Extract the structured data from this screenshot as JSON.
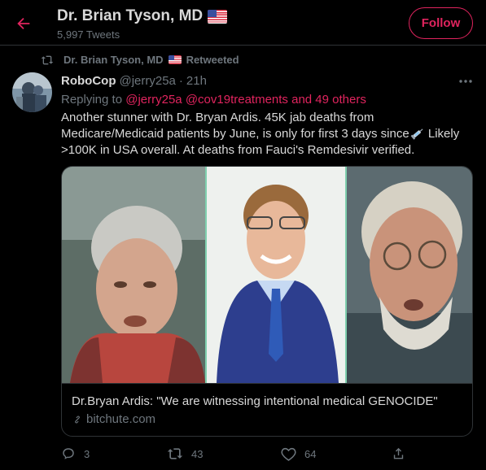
{
  "header": {
    "title": "Dr. Brian Tyson, MD",
    "tweet_count": "5,997 Tweets",
    "follow_label": "Follow"
  },
  "retweet": {
    "label": "Dr. Brian Tyson, MD",
    "suffix": "Retweeted"
  },
  "tweet": {
    "username": "RoboCop",
    "handle": "@jerry25a",
    "separator": "·",
    "time": "21h",
    "replying_prefix": "Replying to",
    "replying_mention1": "@jerry25a",
    "replying_mention2": "@cov19treatments",
    "replying_others": "and 49 others",
    "text_part1": "Another stunner with Dr. Bryan Ardis. 45K jab deaths from Medicare/Medicaid patients by June, is only for first 3 days since",
    "text_part2": " Likely >100K in USA overall. At deaths from Fauci's Remdesivir verified.",
    "emoji_icon": "syringe-icon"
  },
  "card": {
    "title": "Dr.Bryan Ardis: \"We are witnessing intentional medical GENOCIDE\"",
    "domain": "bitchute.com"
  },
  "actions": {
    "reply_count": "3",
    "retweet_count": "43",
    "like_count": "64"
  },
  "colors": {
    "accent": "#e0245e",
    "background": "#000000",
    "muted": "#6e767d",
    "text": "#d9d9d9",
    "border": "#2f3336"
  },
  "icons": [
    "back-arrow-icon",
    "us-flag-icon",
    "retweet-icon",
    "more-icon",
    "syringe-icon",
    "link-icon",
    "reply-icon",
    "like-icon",
    "share-icon"
  ]
}
